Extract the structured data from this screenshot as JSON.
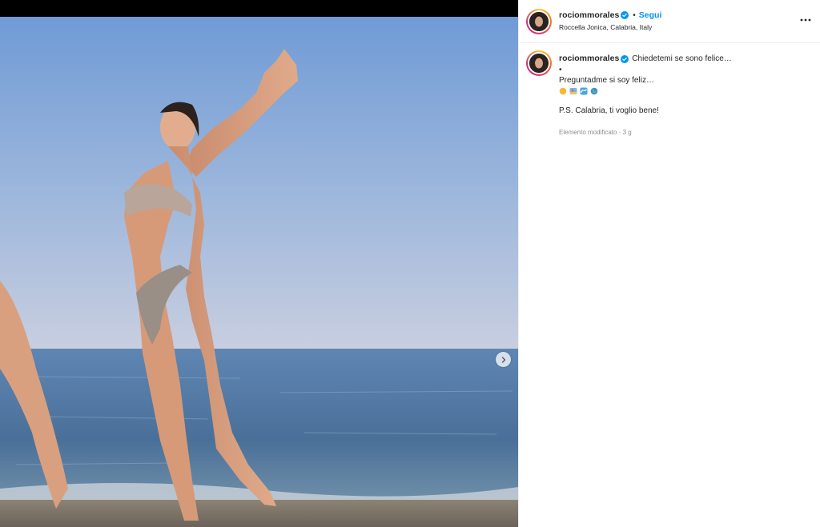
{
  "post": {
    "username": "rociommorales",
    "follow_label": "Segui",
    "separator": "•",
    "location": "Roccella Jonica, Calabria, Italy"
  },
  "caption": {
    "username": "rociommorales",
    "line1": "Chiedetemi se sono felice…",
    "line2": "•",
    "line3": "Preguntadme si soy feliz…",
    "emojis": [
      "sun-emoji",
      "beach-emoji",
      "wave-emoji",
      "globe-emoji"
    ],
    "line5": "P.S. Calabria, ti voglio bene!",
    "edited_label": "Elemento modificato",
    "meta_separator": "·",
    "time_ago": "3 g"
  },
  "colors": {
    "accent_blue": "#0095f6",
    "verified_blue": "#0095f6",
    "text": "#262626",
    "secondary": "#8e8e8e"
  },
  "icons": {
    "next": "chevron-right-icon",
    "more": "more-options-icon",
    "verified": "verified-badge-icon"
  }
}
